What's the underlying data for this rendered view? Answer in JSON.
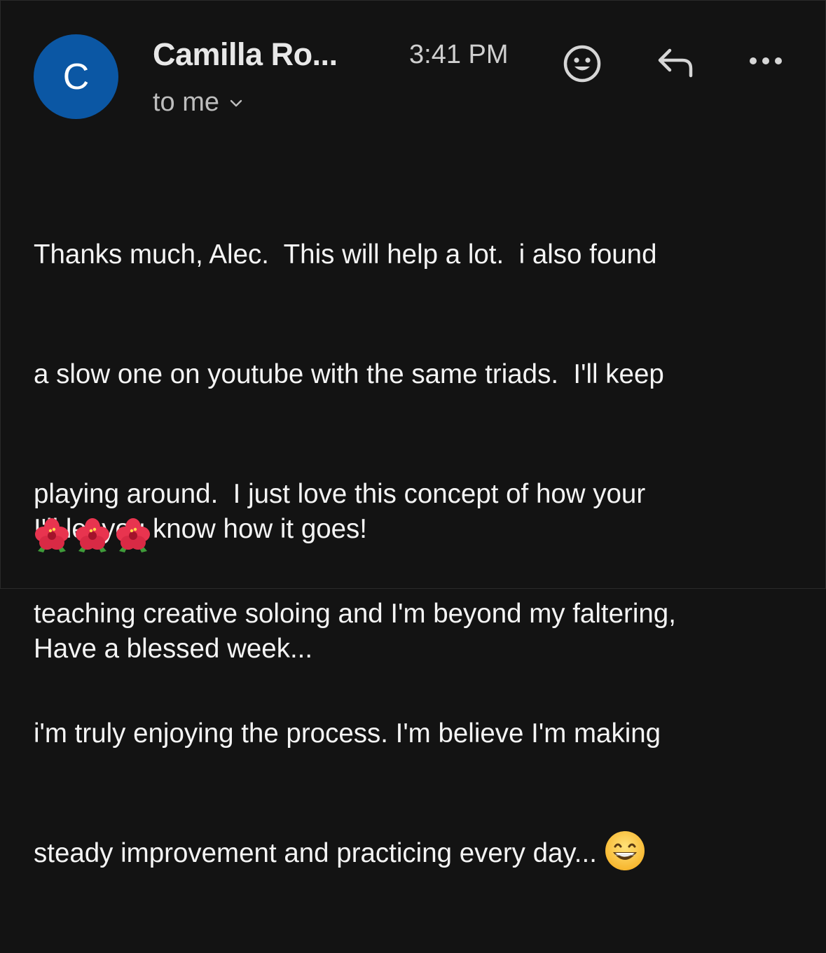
{
  "header": {
    "avatar_letter": "C",
    "sender_name": "Camilla Ro...",
    "time": "3:41 PM",
    "recipient": "to me",
    "avatar_color": "#0b57a4"
  },
  "actions": {
    "emoji_icon": "smiley-icon",
    "reply_icon": "reply-icon",
    "more_icon": "more-horizontal-icon"
  },
  "message": {
    "lines": [
      "Thanks much, Alec.  This will help a lot.  i also found",
      "a slow one on youtube with the same triads.  I'll keep",
      "playing around.  I just love this concept of how your",
      "teaching creative soloing and I'm beyond my faltering,",
      "i'm truly enjoying the process. I'm believe I'm making",
      "steady improvement and practicing every day..."
    ],
    "closing_lines": [
      "I'll let you know how it goes!",
      "Have a blessed week..."
    ],
    "trailing_emoji": "grinning-face-emoji",
    "flower_emoji": "hibiscus-emoji",
    "flower_count": 3
  }
}
